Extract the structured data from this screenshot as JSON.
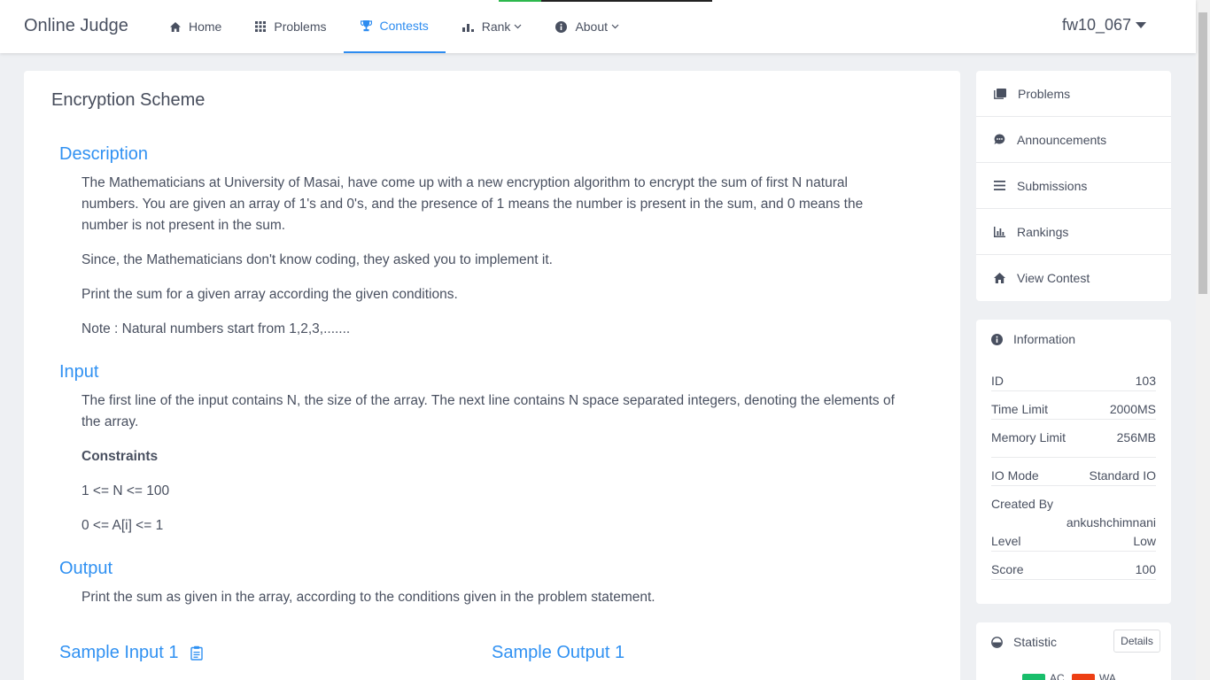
{
  "header": {
    "logo": "Online Judge",
    "nav": [
      {
        "label": "Home",
        "icon": "home-icon"
      },
      {
        "label": "Problems",
        "icon": "grid-icon"
      },
      {
        "label": "Contests",
        "icon": "trophy-icon",
        "active": true
      },
      {
        "label": "Rank",
        "icon": "bar-chart-icon",
        "dropdown": true
      },
      {
        "label": "About",
        "icon": "info-icon",
        "dropdown": true
      }
    ],
    "username": "fw10_067"
  },
  "problem": {
    "title": "Encryption Scheme",
    "description_title": "Description",
    "description": [
      "The Mathematicians at University of Masai, have come up with a new encryption algorithm to encrypt the sum of first N natural numbers. You are given an array of 1's and 0's, and the presence of 1 means the number is present in the sum, and 0 means the number is not present in the sum.",
      "Since, the Mathematicians don't know coding, they asked you to implement it.",
      "Print the sum for a given array according the given conditions.",
      "Note : Natural numbers start from 1,2,3,......."
    ],
    "input_title": "Input",
    "input": [
      "The first line of the input contains N, the size of the array. The next line contains N space separated integers, denoting the elements of the array.",
      "Constraints",
      "1 <= N <= 100",
      "0 <= A[i] <= 1"
    ],
    "output_title": "Output",
    "output": "Print the sum as given in the array, according to the conditions given in the problem statement.",
    "sample_input_title": "Sample Input 1",
    "sample_output_title": "Sample Output 1"
  },
  "sidebar": {
    "menu": [
      {
        "label": "Problems",
        "icon": "book-icon"
      },
      {
        "label": "Announcements",
        "icon": "chat-icon"
      },
      {
        "label": "Submissions",
        "icon": "list-icon"
      },
      {
        "label": "Rankings",
        "icon": "bar-chart-icon"
      },
      {
        "label": "View Contest",
        "icon": "home-icon"
      }
    ],
    "information": {
      "title": "Information",
      "rows": [
        {
          "label": "ID",
          "value": "103"
        },
        {
          "label": "Time Limit",
          "value": "2000MS"
        },
        {
          "label": "Memory Limit",
          "value": "256MB"
        },
        {
          "label": "IO Mode",
          "value": "Standard IO"
        },
        {
          "label": "Created By",
          "value": "ankushchimnani"
        },
        {
          "label": "Level",
          "value": "Low"
        },
        {
          "label": "Score",
          "value": "100"
        }
      ]
    },
    "statistic": {
      "title": "Statistic",
      "details_label": "Details",
      "legend": [
        {
          "label": "AC",
          "color": "#19be6b"
        },
        {
          "label": "WA",
          "color": "#ed3f14"
        }
      ]
    }
  },
  "colors": {
    "accent": "#2d8cf0",
    "section_title": "#3091f2",
    "text": "#495060",
    "background": "#eef0f3"
  }
}
